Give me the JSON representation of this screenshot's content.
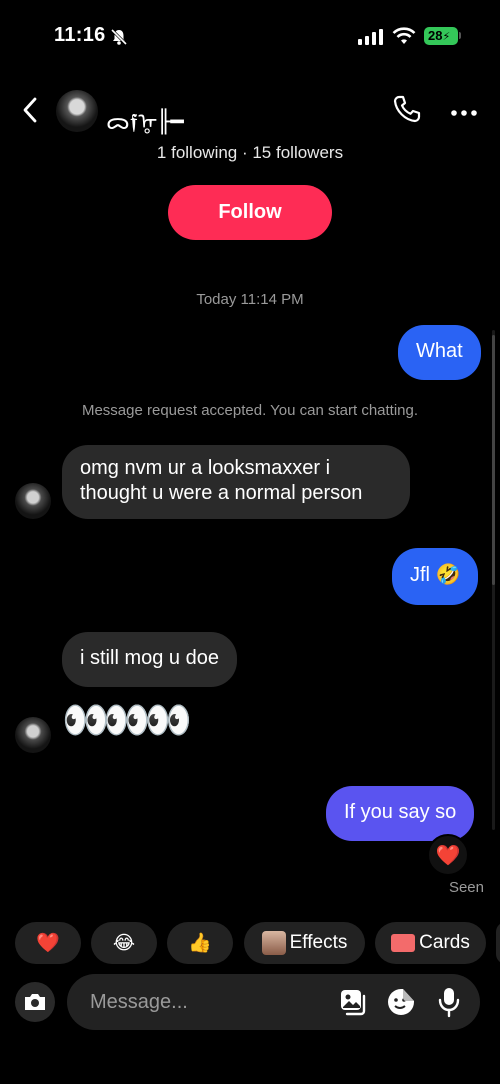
{
  "status_bar": {
    "time": "11:16",
    "battery": "28"
  },
  "header": {
    "name": "ᯅ𝖋ᡎ╟━",
    "follow_stats": "1 following · 15 followers",
    "follow_label": "Follow"
  },
  "chat": {
    "timestamp": "Today 11:14 PM",
    "system_message": "Message request accepted. You can start chatting.",
    "messages": [
      {
        "from": "me",
        "text": "What"
      },
      {
        "from": "them",
        "text": "omg nvm ur a looksmaxxer i thought u were a normal person"
      },
      {
        "from": "me",
        "text": "Jfl 🤣"
      },
      {
        "from": "them",
        "text": "i still mog u doe"
      },
      {
        "from": "them",
        "text": "👀👀👀"
      },
      {
        "from": "me",
        "text": "If you say so"
      }
    ],
    "reaction": "❤️",
    "seen": "Seen"
  },
  "quick_reactions": [
    {
      "label": "❤️"
    },
    {
      "label": "😂"
    },
    {
      "label": "👍"
    },
    {
      "label": "Effects"
    },
    {
      "label": "Cards"
    }
  ],
  "composer": {
    "placeholder": "Message..."
  },
  "colors": {
    "follow": "#fe2c55",
    "outgoing_bubble": "#2a63f4",
    "outgoing_bubble_last": "#5a54f0",
    "incoming_bubble": "#2a2a2a"
  }
}
